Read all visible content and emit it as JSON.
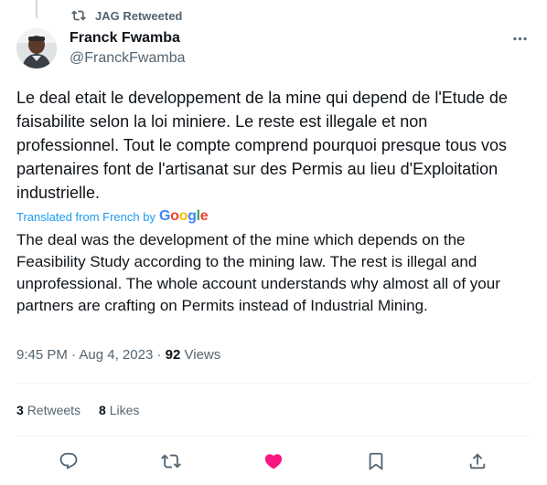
{
  "social_context": {
    "label": "JAG Retweeted",
    "icon": "retweet-icon"
  },
  "author": {
    "name": "Franck Fwamba",
    "handle": "@FranckFwamba",
    "avatar_icon": "profile-photo"
  },
  "tweet": {
    "original_text": "Le deal etait le developpement de la mine qui depend de l'Etude de faisabilite selon la loi miniere. Le reste est illegale et non professionnel. Tout le compte comprend pourquoi presque tous vos partenaires font de l'artisanat sur des Permis au lieu d'Exploitation industrielle.",
    "translated_label": "Translated from French by",
    "translation_provider": "Google",
    "translated_text": "The deal was the development of the mine which depends on the Feasibility Study according to the mining law. The rest is illegal and unprofessional. The whole account understands why almost all of your partners are crafting on Permits instead of Industrial Mining."
  },
  "meta": {
    "time": "9:45 PM",
    "separator": " · ",
    "date": "Aug 4, 2023",
    "views_count": "92",
    "views_label": "Views"
  },
  "stats": {
    "retweets_count": "3",
    "retweets_label": "Retweets",
    "likes_count": "8",
    "likes_label": "Likes"
  },
  "actions": [
    {
      "name": "reply",
      "icon": "reply-icon"
    },
    {
      "name": "retweet",
      "icon": "retweet-icon"
    },
    {
      "name": "like",
      "icon": "heart-filled-icon",
      "color": "#f91880"
    },
    {
      "name": "bookmark",
      "icon": "bookmark-icon"
    },
    {
      "name": "share",
      "icon": "share-icon"
    }
  ],
  "colors": {
    "text_primary": "#0f1419",
    "text_secondary": "#536471",
    "link_blue": "#1d9bf0",
    "like_pink": "#f91880",
    "divider": "#eff3f4"
  }
}
